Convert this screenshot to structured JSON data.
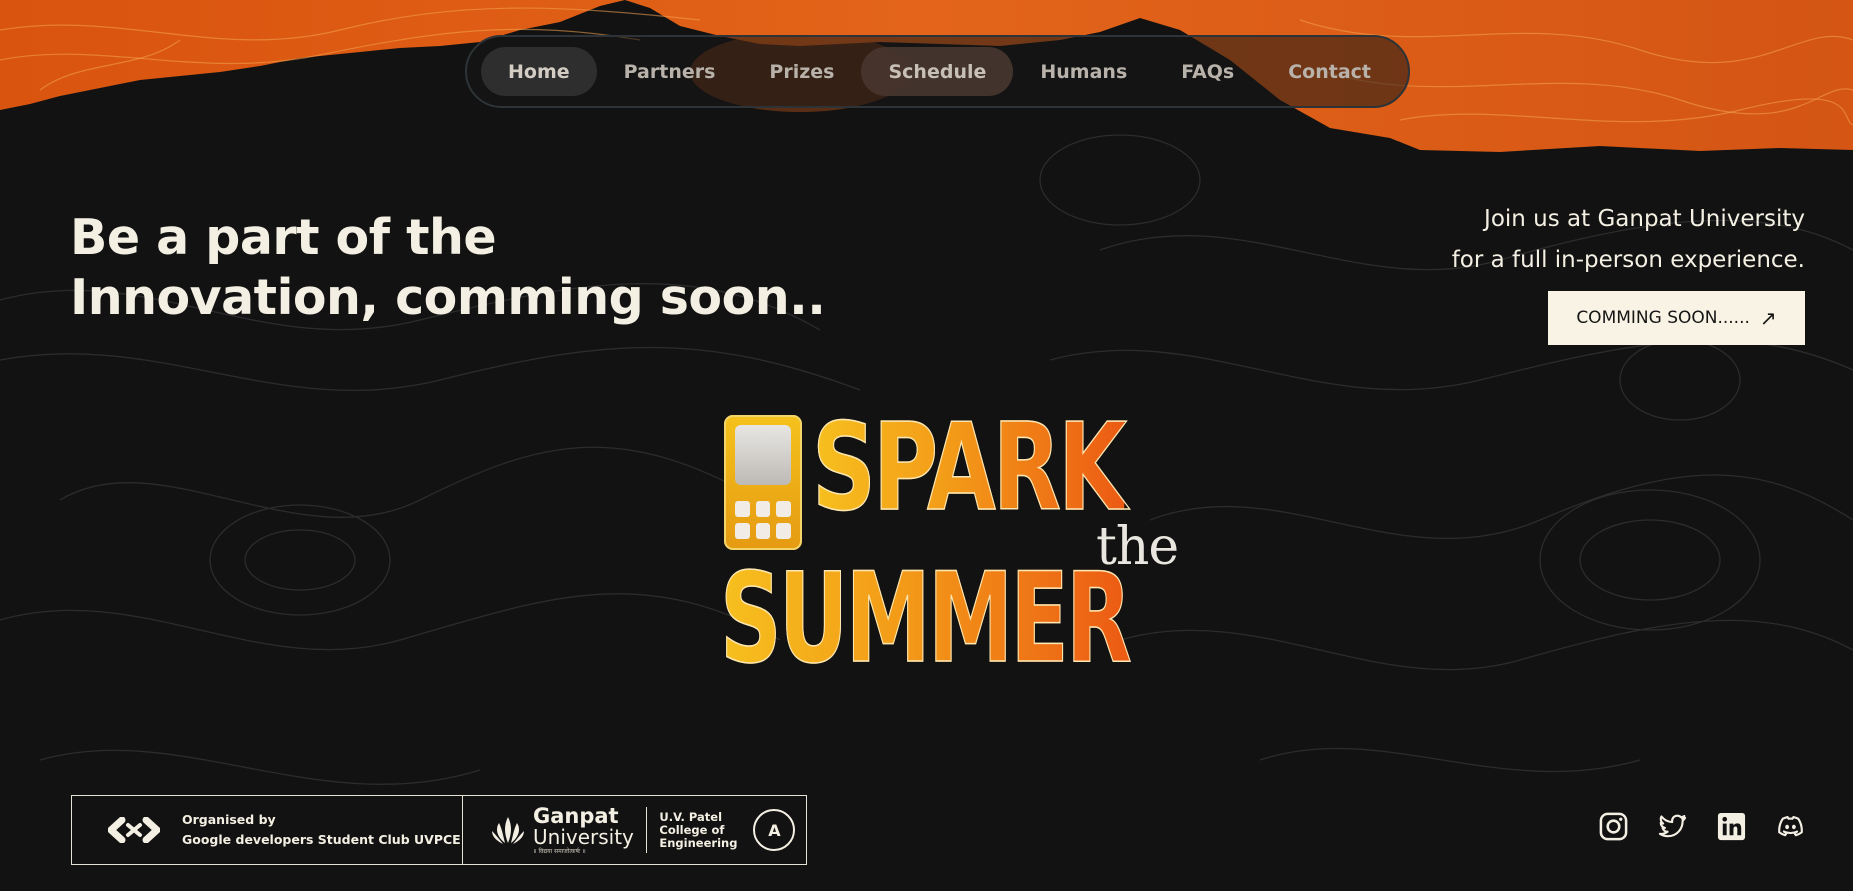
{
  "nav": {
    "items": [
      {
        "label": "Home"
      },
      {
        "label": "Partners"
      },
      {
        "label": "Prizes"
      },
      {
        "label": "Schedule"
      },
      {
        "label": "Humans"
      },
      {
        "label": "FAQs"
      },
      {
        "label": "Contact"
      }
    ],
    "active": "Home"
  },
  "hero": {
    "title_line1": "Be a part of the",
    "title_line2": "Innovation, comming soon.."
  },
  "join": {
    "line1": "Join us at Ganpat University",
    "line2": "for a full in-person experience.",
    "cta_label": "COMMING SOON......",
    "cta_icon": "arrow-up-right-icon"
  },
  "logo": {
    "word1": "SPARK",
    "word2": "the",
    "word3": "SUMMER",
    "icon": "phone-icon"
  },
  "footer": {
    "organised_by_label": "Organised by",
    "organiser": "Google developers Student Club UVPCE",
    "uni_name_1": "Ganpat",
    "uni_name_2": "University",
    "uni_motto": "॥ विद्यया समाजोत्कर्षः ॥",
    "college_1": "U.V. Patel",
    "college_2": "College of",
    "college_3": "Engineering",
    "naac_grade": "A",
    "socials": [
      "instagram-icon",
      "twitter-icon",
      "linkedin-icon",
      "discord-icon"
    ]
  },
  "colors": {
    "background": "#121212",
    "accent_orange": "#e8671a",
    "text_cream": "#f4efe3",
    "cta_bg": "#f8f3e4"
  }
}
